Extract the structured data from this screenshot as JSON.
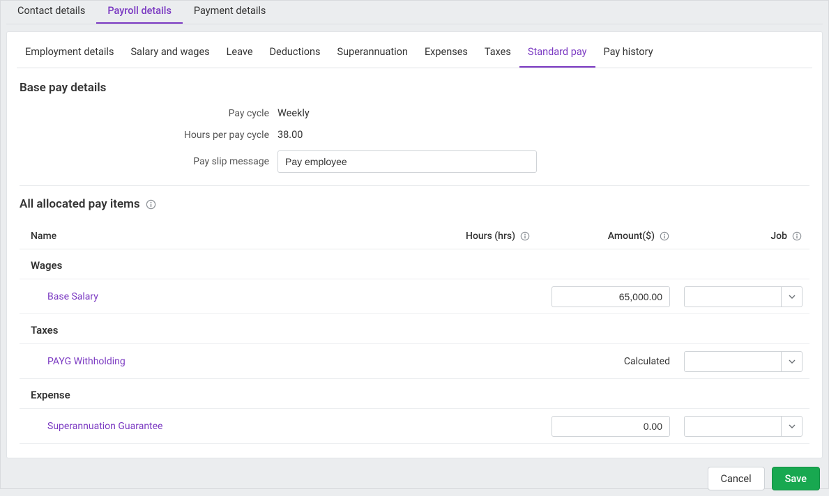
{
  "topTabs": [
    {
      "label": "Contact details",
      "active": false
    },
    {
      "label": "Payroll details",
      "active": true
    },
    {
      "label": "Payment details",
      "active": false
    }
  ],
  "subTabs": [
    {
      "label": "Employment details",
      "active": false
    },
    {
      "label": "Salary and wages",
      "active": false
    },
    {
      "label": "Leave",
      "active": false
    },
    {
      "label": "Deductions",
      "active": false
    },
    {
      "label": "Superannuation",
      "active": false
    },
    {
      "label": "Expenses",
      "active": false
    },
    {
      "label": "Taxes",
      "active": false
    },
    {
      "label": "Standard pay",
      "active": true
    },
    {
      "label": "Pay history",
      "active": false
    }
  ],
  "baseSection": {
    "title": "Base pay details",
    "payCycleLabel": "Pay cycle",
    "payCycleValue": "Weekly",
    "hoursLabel": "Hours per pay cycle",
    "hoursValue": "38.00",
    "messageLabel": "Pay slip message",
    "messageValue": "Pay employee"
  },
  "allocated": {
    "title": "All allocated pay items",
    "columns": {
      "name": "Name",
      "hours": "Hours (hrs)",
      "amount": "Amount($)",
      "job": "Job"
    },
    "groups": [
      {
        "label": "Wages",
        "items": [
          {
            "name": "Base Salary",
            "amountInput": "65,000.00",
            "amountText": null,
            "job": ""
          }
        ]
      },
      {
        "label": "Taxes",
        "items": [
          {
            "name": "PAYG Withholding",
            "amountInput": null,
            "amountText": "Calculated",
            "job": ""
          }
        ]
      },
      {
        "label": "Expense",
        "items": [
          {
            "name": "Superannuation Guarantee",
            "amountInput": "0.00",
            "amountText": null,
            "job": ""
          }
        ]
      }
    ]
  },
  "footer": {
    "cancel": "Cancel",
    "save": "Save"
  }
}
